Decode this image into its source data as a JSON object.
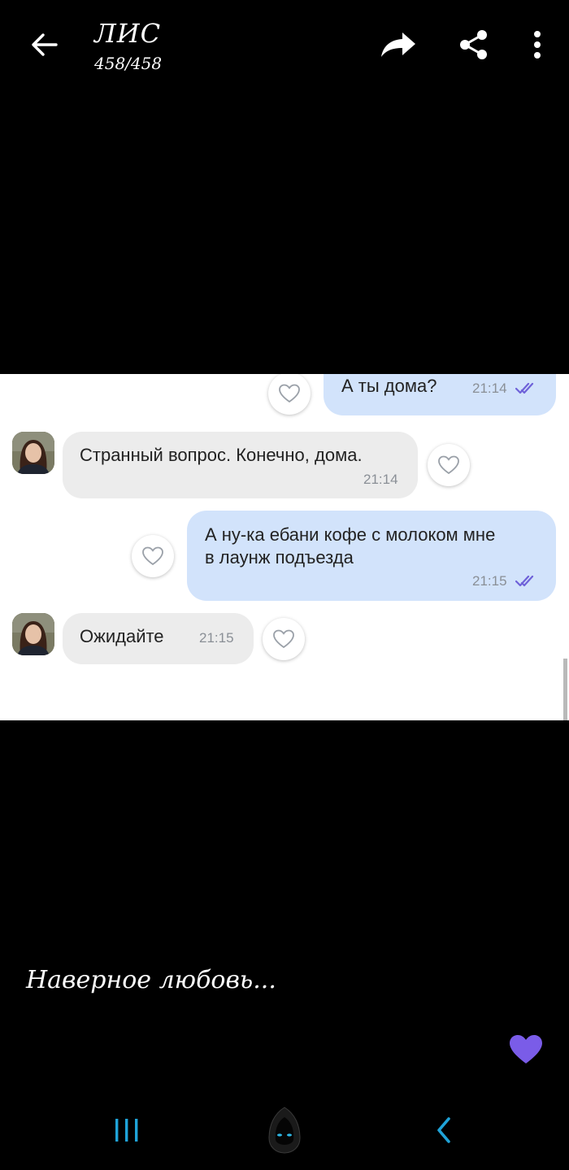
{
  "header": {
    "title": "ЛИС",
    "counter": "458/458"
  },
  "chat": {
    "messages": [
      {
        "direction": "outgoing",
        "text": "А ты дома?",
        "time": "21:14"
      },
      {
        "direction": "incoming",
        "text": "Странный вопрос. Конечно, дома.",
        "time": "21:14"
      },
      {
        "direction": "outgoing",
        "text_line1": "А ну-ка ебани кофе с молоком мне",
        "text_line2": "в лаунж подъезда",
        "time": "21:15"
      },
      {
        "direction": "incoming",
        "text": "Ожидайте",
        "time": "21:15"
      }
    ]
  },
  "caption": "Наверное любовь...",
  "colors": {
    "accent": "#7a5ce8",
    "outgoing_bubble": "#d2e3fb",
    "incoming_bubble": "#ececec",
    "read_check": "#6f62d9",
    "nav_icon": "#1fa3d8"
  },
  "icons": {
    "back": "arrow-left-icon",
    "forward": "forward-arrow-icon",
    "share": "share-icon",
    "more": "more-vertical-icon",
    "like": "heart-outline-icon",
    "like_big": "heart-filled-icon",
    "nav_recents": "recents-icon",
    "nav_home": "home-icon",
    "nav_back": "nav-back-icon"
  }
}
